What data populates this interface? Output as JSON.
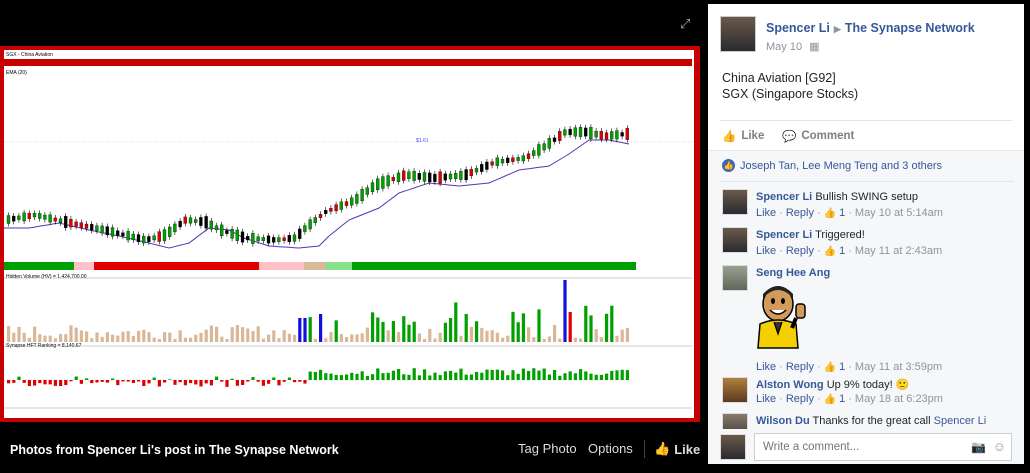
{
  "viewer": {
    "caption": "Photos from Spencer Li's post in The Synapse Network",
    "tag_photo": "Tag Photo",
    "options": "Options",
    "like": "Like",
    "chart_title": "SGX - China Aviation",
    "ema_label": "EMA (20)",
    "volume_label": "Hidden Volume (HV) = 1,424,700.00",
    "ranking_label": "Synapse HFT Ranking = 8,140.67",
    "price_marker": "$1.61"
  },
  "post": {
    "author": "Spencer Li",
    "group": "The Synapse Network",
    "date": "May 10",
    "text_line1": "China Aviation [G92]",
    "text_line2": "SGX (Singapore Stocks)",
    "like_label": "Like",
    "comment_label": "Comment",
    "likers": "Joseph Tan, Lee Meng Teng and 3 others"
  },
  "comments": [
    {
      "author": "Spencer Li",
      "text": "Bullish SWING setup",
      "like": "Like",
      "reply": "Reply",
      "likes": "1",
      "time": "May 10 at 5:14am"
    },
    {
      "author": "Spencer Li",
      "text": "Triggered!",
      "like": "Like",
      "reply": "Reply",
      "likes": "1",
      "time": "May 11 at 2:43am"
    },
    {
      "author": "Seng Hee Ang",
      "text": "",
      "like": "Like",
      "reply": "Reply",
      "likes": "1",
      "time": "May 11 at 3:59pm"
    },
    {
      "author": "Alston Wong",
      "text": "Up 9% today! 🙂",
      "like": "Like",
      "reply": "Reply",
      "likes": "1",
      "time": "May 18 at 6:23pm"
    },
    {
      "author": "Wilson Du",
      "text": "Thanks for the great call",
      "mention": "Spencer Li"
    }
  ],
  "write_comment": {
    "placeholder": "Write a comment..."
  },
  "icons": {
    "expand": "expand-icon",
    "thumb": "thumbs-up-icon",
    "comment": "comment-bubble-icon",
    "camera": "camera-icon",
    "smile": "smile-icon",
    "audience": "audience-icon"
  },
  "colors": {
    "link": "#365899",
    "frame": "#c80000",
    "up": "#00a000",
    "down": "#e00000"
  }
}
